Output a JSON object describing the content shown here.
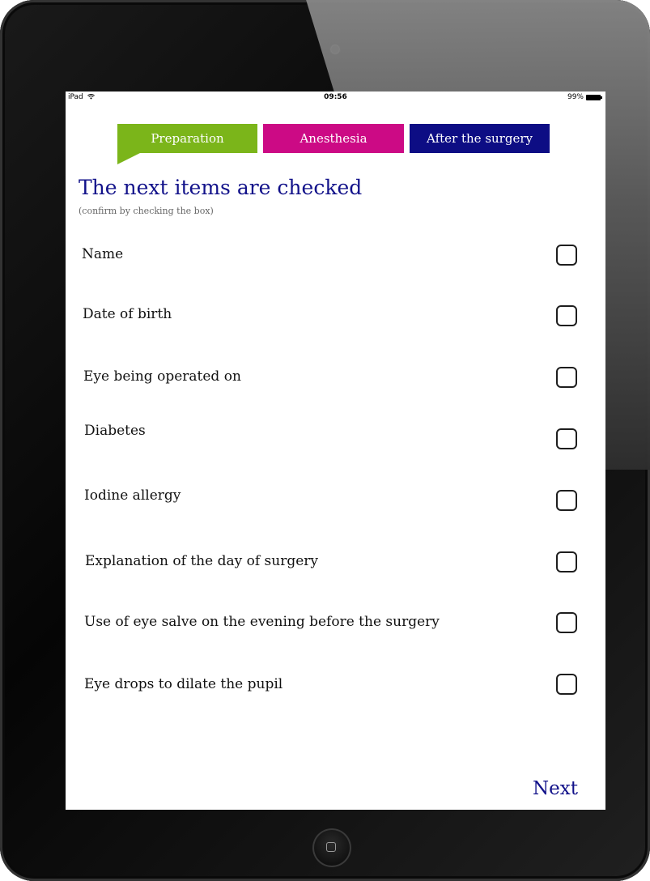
{
  "status_bar": {
    "device": "iPad",
    "wifi_icon": "wifi-icon",
    "time": "09:56",
    "battery": "99%"
  },
  "tabs": [
    {
      "label": "Preparation",
      "color": "#7bb51a",
      "active": true
    },
    {
      "label": "Anesthesia",
      "color": "#cc0a85",
      "active": false
    },
    {
      "label": "After the surgery",
      "color": "#0d0d84",
      "active": false
    }
  ],
  "header": {
    "title": "The next items are checked",
    "subtitle": "(confirm by checking the box)"
  },
  "checklist": [
    {
      "label": "Name",
      "checked": false
    },
    {
      "label": "Date of birth",
      "checked": false
    },
    {
      "label": "Eye being operated on",
      "checked": false
    },
    {
      "label": "Diabetes",
      "checked": false
    },
    {
      "label": "Iodine allergy",
      "checked": false
    },
    {
      "label": "Explanation of the day of surgery",
      "checked": false
    },
    {
      "label": "Use of eye salve on the evening before the surgery",
      "checked": false
    },
    {
      "label": "Eye drops to dilate the pupil",
      "checked": false
    }
  ],
  "footer": {
    "next_label": "Next"
  },
  "colors": {
    "title_blue": "#12128a",
    "checkbox_border": "#1e1e1e"
  }
}
